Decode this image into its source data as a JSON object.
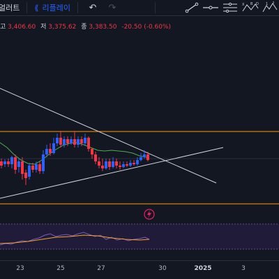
{
  "toolbar": {
    "alert_label": "얼러트",
    "replay_icon": "⟪",
    "replay_label": "리플레이",
    "undo_icon": "↶",
    "redo_icon": "↷",
    "icons": [
      "trend-line-icon",
      "horizontal-line-icon",
      "parallel-channel-icon",
      "pattern-icon",
      "elliott-wave-icon"
    ]
  },
  "ohlc": {
    "high_label": "고",
    "high": "3,406.60",
    "low_label": "저",
    "low": "3,375.62",
    "close_label": "종",
    "close": "3,383.50",
    "change": "-20.50 (-0.60%)"
  },
  "xaxis": {
    "ticks": [
      "23",
      "25",
      "27",
      "30",
      "2025",
      "3"
    ]
  },
  "colors": {
    "background": "#131722",
    "up": "#2962ff",
    "down": "#f23645",
    "ma": "#4caf50",
    "box": "#ff9800",
    "rsi_bg": "#2a1f4a",
    "rsi_line": "#7e57c2",
    "rsi_ma": "#f5a623",
    "trendline": "#d1d4dc"
  },
  "icons": {
    "flash_alert": "lightning-icon"
  }
}
